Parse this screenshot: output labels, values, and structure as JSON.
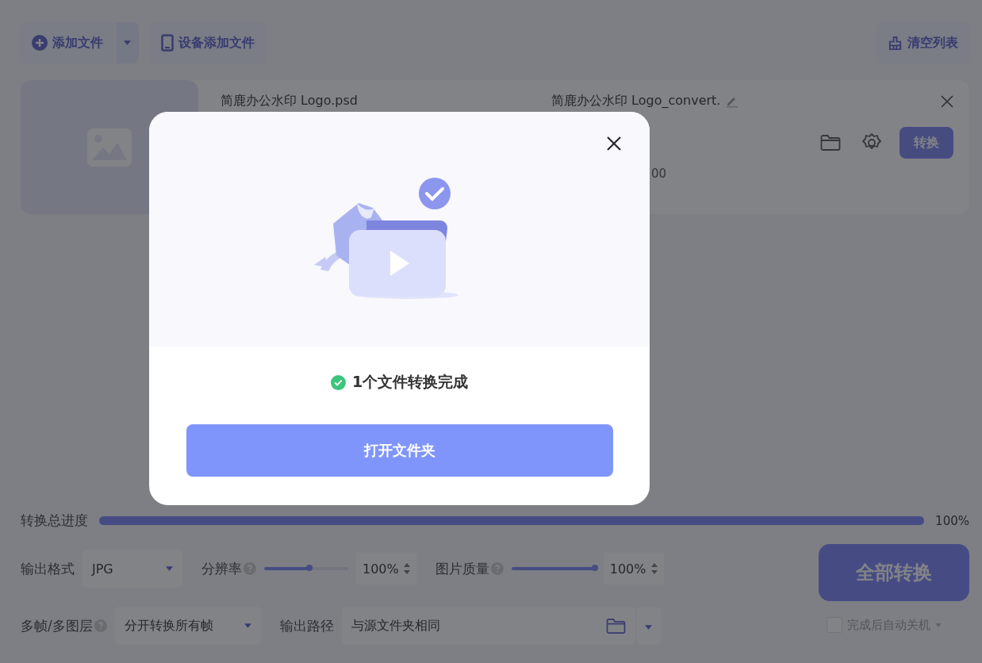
{
  "toolbar": {
    "add_file": "添加文件",
    "device_add": "设备添加文件",
    "clear_list": "清空列表"
  },
  "file": {
    "source_name": "简鹿办公水印 Logo.psd",
    "output_name": "简鹿办公水印 Logo_convert.",
    "partial_text": "00",
    "convert": "转换"
  },
  "progress": {
    "label": "转换总进度",
    "level": 1,
    "reading": "100%"
  },
  "settings": {
    "format_label": "输出格式",
    "format_value": "JPG",
    "resolution": {
      "label": "分辨率",
      "level": 0.55,
      "value": "100%"
    },
    "quality": {
      "label": "图片质量",
      "level": 1,
      "value": "100%"
    },
    "frames_label": "多帧/多图层",
    "frames_value": "分开转换所有帧",
    "path_label": "输出路径",
    "path_value": "与源文件夹相同"
  },
  "convert_all": "全部转换",
  "auto_shutdown": {
    "label": "完成后自动关机",
    "checked": false
  },
  "dialog": {
    "status": "1个文件转换完成",
    "button": "打开文件夹"
  }
}
